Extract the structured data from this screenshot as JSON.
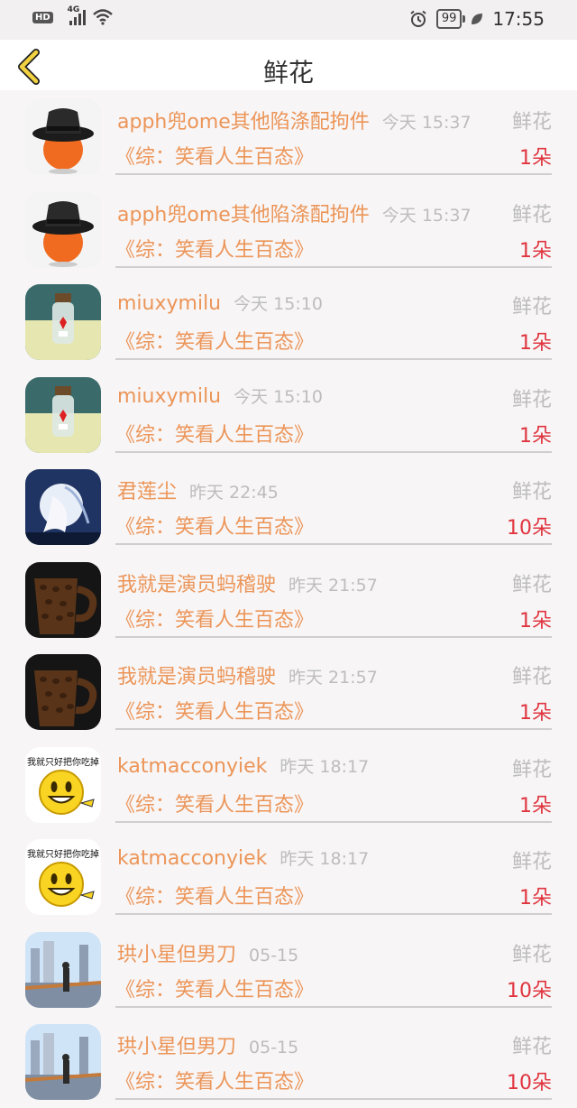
{
  "status_bar": {
    "hd": "HD",
    "network": "4G",
    "battery": "99",
    "time": "17:55"
  },
  "header": {
    "title": "鲜花"
  },
  "items": [
    {
      "avatar": "hat-orange",
      "name": "apph兜ome其他陷涤配拘件",
      "time": "今天 15:37",
      "kind": "鲜花",
      "book": "《综：笑看人生百态》",
      "count": "1朵"
    },
    {
      "avatar": "hat-orange",
      "name": "apph兜ome其他陷涤配拘件",
      "time": "今天 15:37",
      "kind": "鲜花",
      "book": "《综：笑看人生百态》",
      "count": "1朵"
    },
    {
      "avatar": "bottle",
      "name": "miuxymilu",
      "time": "今天 15:10",
      "kind": "鲜花",
      "book": "《综：笑看人生百态》",
      "count": "1朵"
    },
    {
      "avatar": "bottle",
      "name": "miuxymilu",
      "time": "今天 15:10",
      "kind": "鲜花",
      "book": "《综：笑看人生百态》",
      "count": "1朵"
    },
    {
      "avatar": "anime-moon",
      "name": "君莲尘",
      "time": "昨天 22:45",
      "kind": "鲜花",
      "book": "《综：笑看人生百态》",
      "count": "10朵"
    },
    {
      "avatar": "coffee-mug",
      "name": "我就是演员蚂稽驶",
      "time": "昨天 21:57",
      "kind": "鲜花",
      "book": "《综：笑看人生百态》",
      "count": "1朵"
    },
    {
      "avatar": "coffee-mug",
      "name": "我就是演员蚂稽驶",
      "time": "昨天 21:57",
      "kind": "鲜花",
      "book": "《综：笑看人生百态》",
      "count": "1朵"
    },
    {
      "avatar": "smiley",
      "avatar_text": "我就只好把你吃掉",
      "name": "katmacconyiek",
      "time": "昨天 18:17",
      "kind": "鲜花",
      "book": "《综：笑看人生百态》",
      "count": "1朵"
    },
    {
      "avatar": "smiley",
      "avatar_text": "我就只好把你吃掉",
      "name": "katmacconyiek",
      "time": "昨天 18:17",
      "kind": "鲜花",
      "book": "《综：笑看人生百态》",
      "count": "1朵"
    },
    {
      "avatar": "city-girl",
      "name": "珙小星但男刀",
      "time": "05-15",
      "kind": "鲜花",
      "book": "《综：笑看人生百态》",
      "count": "10朵"
    },
    {
      "avatar": "city-girl",
      "name": "珙小星但男刀",
      "time": "05-15",
      "kind": "鲜花",
      "book": "《综：笑看人生百态》",
      "count": "10朵"
    }
  ]
}
